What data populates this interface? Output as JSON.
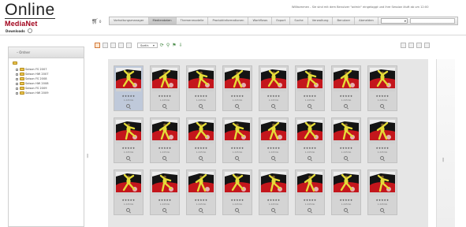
{
  "header": {
    "logo_main": "Online",
    "logo_sub": "MediaNet",
    "user_label": "Downloads",
    "welcome": "Willkommen - Sie sind mit dem Benutzer \"admin\" eingeloggt und Ihre Session läuft ab um 12:00",
    "cart_count": "0"
  },
  "tabs": [
    {
      "label": "Vorhaltungsmanager",
      "active": false
    },
    {
      "label": "Mediendaten",
      "active": true
    },
    {
      "label": "Themenmodelle",
      "active": false
    },
    {
      "label": "Produktinformationen",
      "active": false
    },
    {
      "label": "Workflows",
      "active": false
    },
    {
      "label": "Export",
      "active": false
    },
    {
      "label": "Suche",
      "active": false
    },
    {
      "label": "Verwaltung",
      "active": false
    },
    {
      "label": "Benutzer",
      "active": false
    },
    {
      "label": "Abmelden",
      "active": false
    }
  ],
  "tab_select": {
    "value": ""
  },
  "sidebar": {
    "title": "Ordner",
    "root_label": "",
    "items": [
      {
        "label": "Saison FS 2007"
      },
      {
        "label": "Saison HW 2007"
      },
      {
        "label": "Saison FS 2008"
      },
      {
        "label": "Saison HW 2008"
      },
      {
        "label": "Saison FS 2009"
      },
      {
        "label": "Saison HW 2009"
      }
    ]
  },
  "toolbar": {
    "sort_label": "Sortir.",
    "sort_arrow": "▾"
  },
  "gallery": {
    "rating": "★★★★★",
    "info_text": "1.245mb",
    "selected_index": 0,
    "tiles": [
      {
        "pose": "a"
      },
      {
        "pose": "b"
      },
      {
        "pose": "c"
      },
      {
        "pose": "b"
      },
      {
        "pose": "a"
      },
      {
        "pose": "c"
      },
      {
        "pose": "b"
      },
      {
        "pose": "a"
      },
      {
        "pose": "c"
      },
      {
        "pose": "b"
      },
      {
        "pose": "a"
      },
      {
        "pose": "c"
      },
      {
        "pose": "b"
      },
      {
        "pose": "a"
      },
      {
        "pose": "c"
      },
      {
        "pose": "b"
      },
      {
        "pose": "a"
      },
      {
        "pose": "c"
      },
      {
        "pose": "b"
      },
      {
        "pose": "a"
      },
      {
        "pose": "c"
      },
      {
        "pose": "b"
      },
      {
        "pose": "a"
      },
      {
        "pose": "c"
      }
    ]
  },
  "colors": {
    "accent": "#a0001a",
    "figure": "#e5dc38",
    "car": "#c4161c",
    "dark": "#141414"
  }
}
